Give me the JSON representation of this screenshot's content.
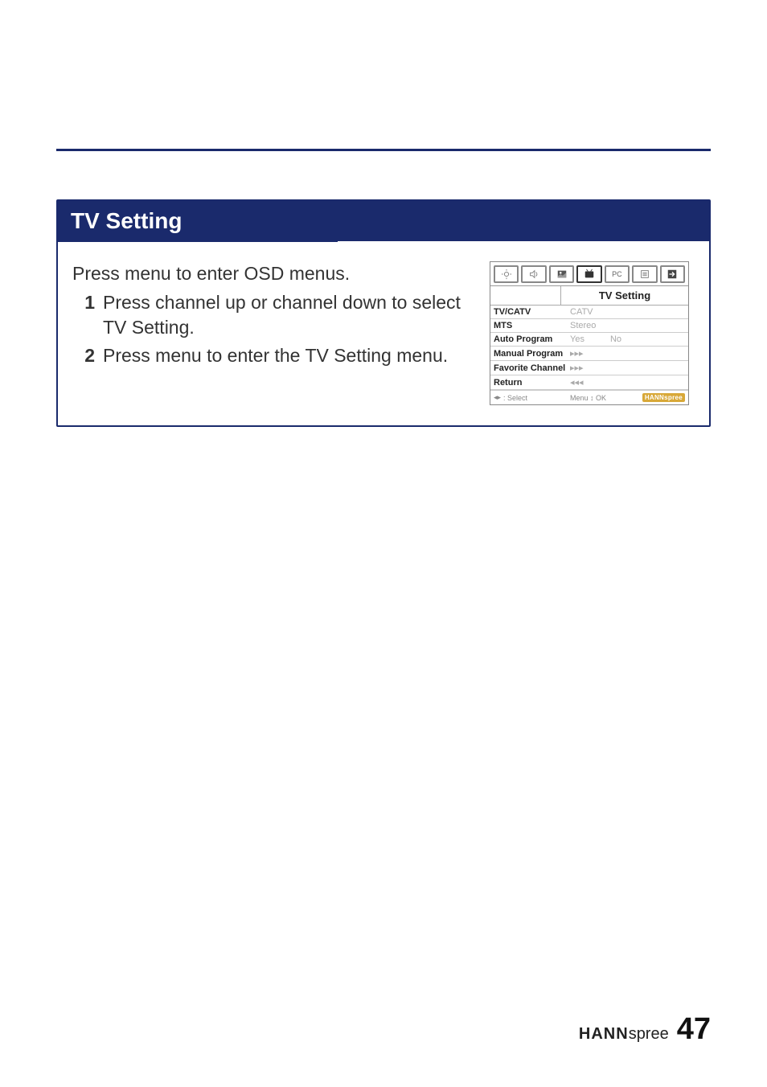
{
  "section": {
    "title": "TV Setting",
    "intro": "Press menu to enter OSD menus.",
    "steps": [
      {
        "num": "1",
        "text": "Press channel up or channel down to select TV Setting."
      },
      {
        "num": "2",
        "text": "Press menu to enter the TV Setting menu."
      }
    ]
  },
  "osd": {
    "tab_pc": "PC",
    "title": "TV Setting",
    "rows": {
      "tv_catv": {
        "label": "TV/CATV",
        "value": "CATV"
      },
      "mts": {
        "label": "MTS",
        "value": "Stereo"
      },
      "auto_program": {
        "label": "Auto Program",
        "value": "Yes",
        "value2": "No"
      },
      "manual_program": {
        "label": "Manual Program",
        "value": "▸▸▸"
      },
      "favorite_channel": {
        "label": "Favorite Channel",
        "value": "▸▸▸"
      },
      "return": {
        "label": "Return",
        "value": "◂◂◂"
      }
    },
    "footer": {
      "select": ": Select",
      "menu": "Menu ↕ OK",
      "brand": "HANNspree"
    }
  },
  "footer": {
    "brand1": "HANN",
    "brand2": "spree",
    "page": "47"
  }
}
